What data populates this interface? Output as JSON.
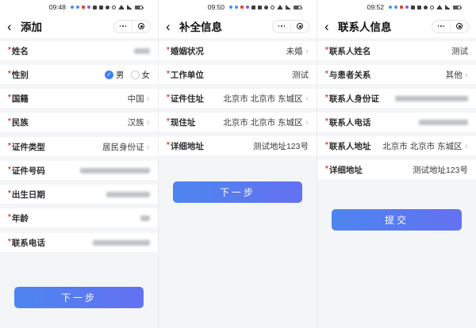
{
  "colors": {
    "accent_blue": "#3e82f4",
    "button_gradient_start": "#4d85ef",
    "button_gradient_end": "#6471f2",
    "required_asterisk_red": "#d6433a",
    "page_background": "#f4f5f7"
  },
  "status_icons": [
    "notif-dot-blue",
    "notif-dot-blue",
    "notif-square-red",
    "notif-dot-purple",
    "app-icon",
    "app-icon",
    "vibrate-icon",
    "alarm-icon",
    "wifi-icon",
    "signal-icon",
    "battery-icon"
  ],
  "capsule": {
    "more_name": "more-menu",
    "minimize_name": "minimize-target"
  },
  "panels": [
    {
      "status_time": "09:48",
      "nav_title": "添加",
      "button_label": "下一步",
      "rows": [
        {
          "label": "姓名",
          "required": true,
          "masked": true,
          "masked_width": 20,
          "chevron": false
        },
        {
          "label": "性别",
          "required": true,
          "type": "radio",
          "options": [
            {
              "label": "男",
              "checked": true
            },
            {
              "label": "女",
              "checked": false
            }
          ]
        },
        {
          "label": "国籍",
          "required": true,
          "value": "中国",
          "chevron": true
        },
        {
          "label": "民族",
          "required": true,
          "value": "汉族",
          "chevron": true
        },
        {
          "label": "证件类型",
          "required": true,
          "value": "居民身份证",
          "chevron": true,
          "gap_before": true
        },
        {
          "label": "证件号码",
          "required": true,
          "masked": true,
          "masked_width": 88
        },
        {
          "label": "出生日期",
          "required": true,
          "masked": true,
          "masked_width": 55
        },
        {
          "label": "年龄",
          "required": true,
          "masked": true,
          "masked_width": 12
        },
        {
          "label": "联系电话",
          "required": true,
          "masked": true,
          "masked_width": 72,
          "gap_before": true
        }
      ]
    },
    {
      "status_time": "09:50",
      "nav_title": "补全信息",
      "button_label": "下一步",
      "rows": [
        {
          "label": "婚姻状况",
          "required": true,
          "value": "未婚",
          "chevron": true
        },
        {
          "label": "工作单位",
          "required": true,
          "value": "测试",
          "chevron": false
        },
        {
          "label": "证件住址",
          "required": true,
          "value": "北京市 北京市 东城区",
          "chevron": true
        },
        {
          "label": "现住址",
          "required": true,
          "value": "北京市 北京市 东城区",
          "chevron": true
        },
        {
          "label": "详细地址",
          "required": true,
          "value": "测试地址123号",
          "chevron": false
        }
      ]
    },
    {
      "status_time": "09:52",
      "nav_title": "联系人信息",
      "button_label": "提交",
      "rows": [
        {
          "label": "联系人姓名",
          "required": true,
          "value": "测试",
          "chevron": false
        },
        {
          "label": "与患者关系",
          "required": true,
          "value": "其他",
          "chevron": true
        },
        {
          "label": "联系人身份证",
          "required": true,
          "masked": true,
          "masked_width": 92
        },
        {
          "label": "联系人电话",
          "required": true,
          "masked": true,
          "masked_width": 62
        },
        {
          "label": "联系人地址",
          "required": true,
          "value": "北京市 北京市 东城区",
          "chevron": true
        },
        {
          "label": "详细地址",
          "required": true,
          "value": "测试地址123号",
          "chevron": false
        }
      ]
    }
  ]
}
